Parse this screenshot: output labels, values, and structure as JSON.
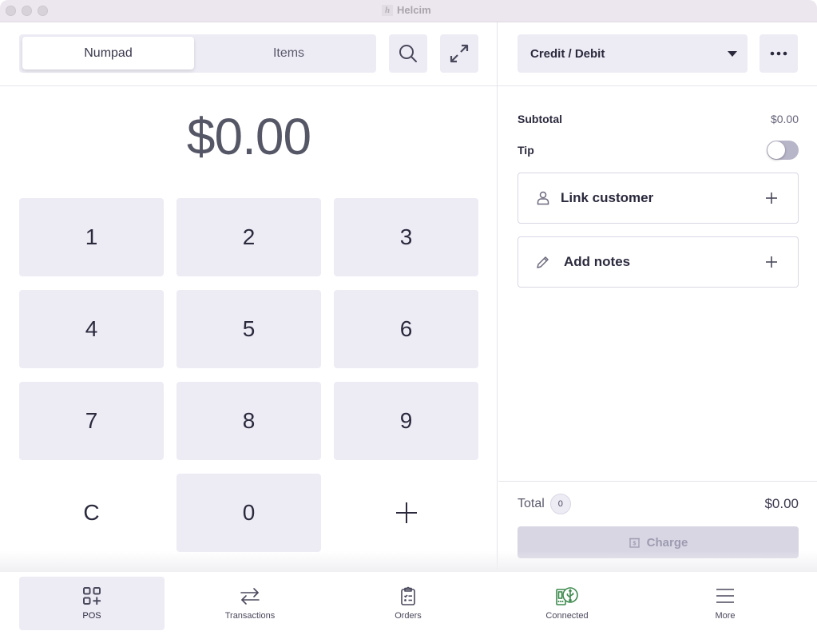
{
  "window": {
    "title": "Helcim",
    "logo_glyph": "h"
  },
  "mode_tabs": [
    {
      "label": "Numpad",
      "active": true
    },
    {
      "label": "Items",
      "active": false
    }
  ],
  "toolbar": {
    "search_icon": "search-icon",
    "expand_icon": "expand-arrows-icon"
  },
  "numpad": {
    "amount": "$0.00",
    "keys": [
      "1",
      "2",
      "3",
      "4",
      "5",
      "6",
      "7",
      "8",
      "9",
      "C",
      "0",
      "+"
    ]
  },
  "payment": {
    "method_selected": "Credit / Debit",
    "more_icon": "ellipsis-icon"
  },
  "summary": {
    "subtotal_label": "Subtotal",
    "subtotal_value": "$0.00",
    "tip_label": "Tip",
    "tip_enabled": false,
    "link_customer_label": "Link customer",
    "add_notes_label": "Add notes",
    "total_label": "Total",
    "item_count": "0",
    "total_value": "$0.00",
    "charge_label": "Charge"
  },
  "bottom_nav": [
    {
      "label": "POS",
      "icon": "pos-grid-icon",
      "active": true
    },
    {
      "label": "Transactions",
      "icon": "transfer-arrows-icon",
      "active": false
    },
    {
      "label": "Orders",
      "icon": "clipboard-icon",
      "active": false
    },
    {
      "label": "Connected",
      "icon": "usb-terminal-icon",
      "active": false
    },
    {
      "label": "More",
      "icon": "hamburger-menu-icon",
      "active": false
    }
  ],
  "colors": {
    "connected_green": "#3f8a4f",
    "accent_bg": "#edecf5",
    "text_dark": "#2b2a3d"
  }
}
